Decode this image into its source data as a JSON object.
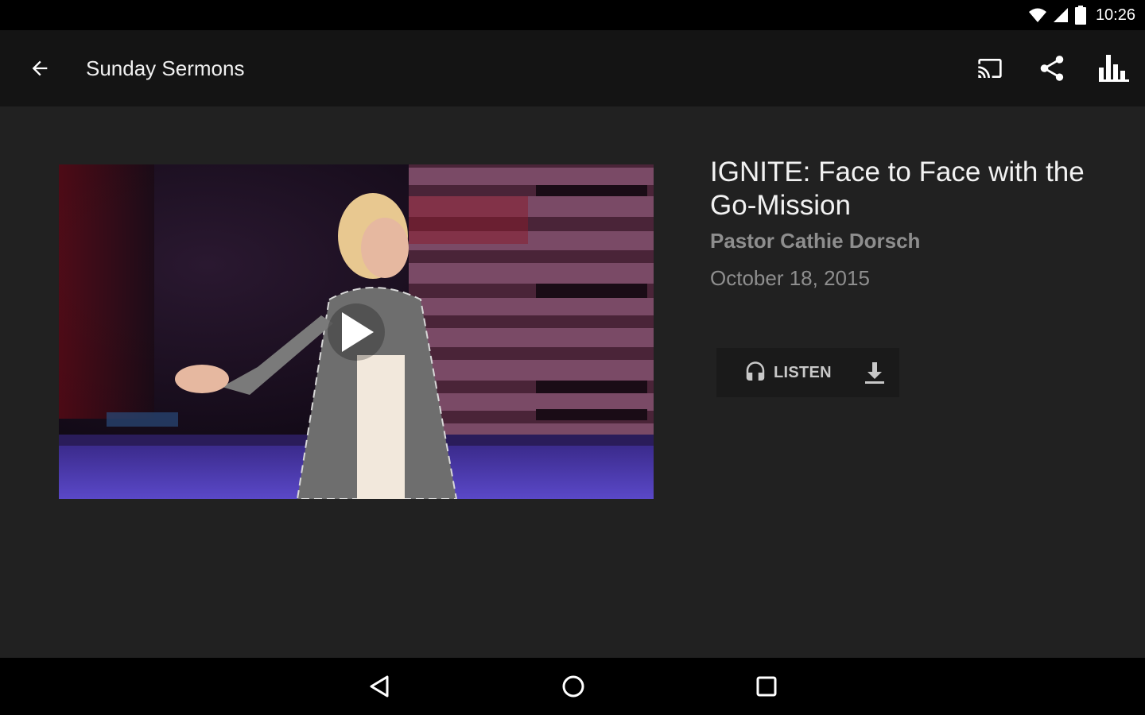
{
  "status_bar": {
    "time": "10:26",
    "icons": [
      "wifi-icon",
      "signal-icon",
      "battery-icon"
    ]
  },
  "app_bar": {
    "title": "Sunday Sermons",
    "back_icon": "arrow-left-icon",
    "actions": [
      "cast-icon",
      "share-icon",
      "bar-chart-icon"
    ]
  },
  "sermon": {
    "title": "IGNITE: Face to Face with the Go-Mission",
    "speaker": "Pastor Cathie Dorsch",
    "date": "October 18, 2015"
  },
  "media": {
    "listen_label": "LISTEN",
    "listen_icon": "headphones-icon",
    "download_icon": "download-icon",
    "play_icon": "play-icon"
  },
  "nav_bar": {
    "buttons": [
      "back-triangle-icon",
      "home-circle-icon",
      "recents-square-icon"
    ]
  },
  "colors": {
    "background": "#212121",
    "app_bar": "#141414",
    "system_bars": "#000000",
    "secondary_text": "#8e8e8e"
  }
}
